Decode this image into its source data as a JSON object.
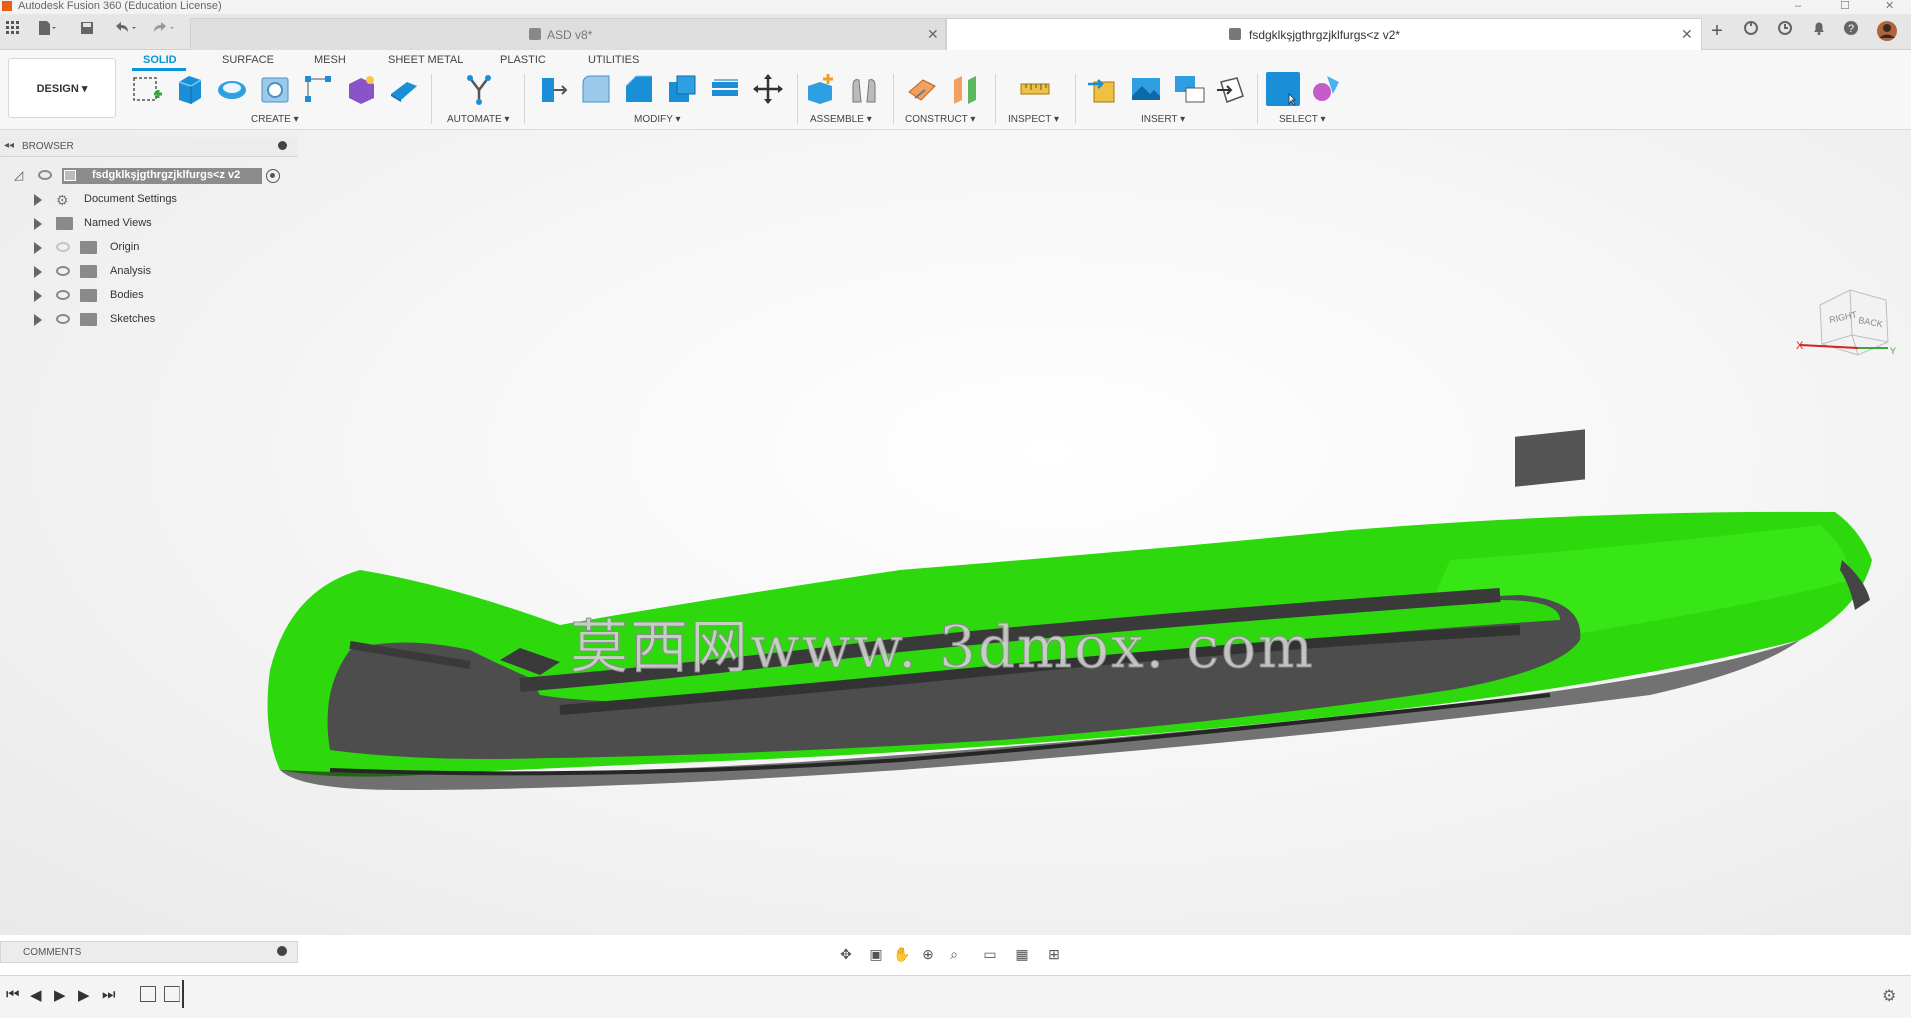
{
  "window": {
    "title": "Autodesk Fusion 360 (Education License)",
    "controls": [
      "–",
      "☐",
      "✕"
    ]
  },
  "tabs": [
    {
      "label": "ASD v8*",
      "active": false
    },
    {
      "label": "fsdgklkşjgthrgzjklfurgs<z v2*",
      "active": true
    }
  ],
  "ribbon": {
    "workspace": "DESIGN",
    "tabs": [
      "SOLID",
      "SURFACE",
      "MESH",
      "SHEET METAL",
      "PLASTIC",
      "UTILITIES"
    ],
    "active_tab": "SOLID",
    "groups": [
      "CREATE",
      "AUTOMATE",
      "MODIFY",
      "ASSEMBLE",
      "CONSTRUCT",
      "INSPECT",
      "INSERT",
      "SELECT"
    ]
  },
  "browser": {
    "title": "BROWSER",
    "root": "fsdgklkşjgthrgzjklfurgs<z v2",
    "items": [
      {
        "label": "Document Settings",
        "icon": "gear-icon"
      },
      {
        "label": "Named Views",
        "icon": "folder-icon"
      },
      {
        "label": "Origin",
        "icon": "folder-icon",
        "hidden": true
      },
      {
        "label": "Analysis",
        "icon": "folder-icon"
      },
      {
        "label": "Bodies",
        "icon": "folder-icon"
      },
      {
        "label": "Sketches",
        "icon": "folder-icon"
      }
    ]
  },
  "viewcube": {
    "faces": [
      "RIGHT",
      "BACK"
    ],
    "axes": [
      "X",
      "Y"
    ]
  },
  "watermark": "莫西网www. 3dmox. com",
  "comments": {
    "title": "COMMENTS"
  },
  "colors": {
    "accent": "#0696d7",
    "model_green": "#2dd80d",
    "model_dark": "#4a4a4a"
  }
}
